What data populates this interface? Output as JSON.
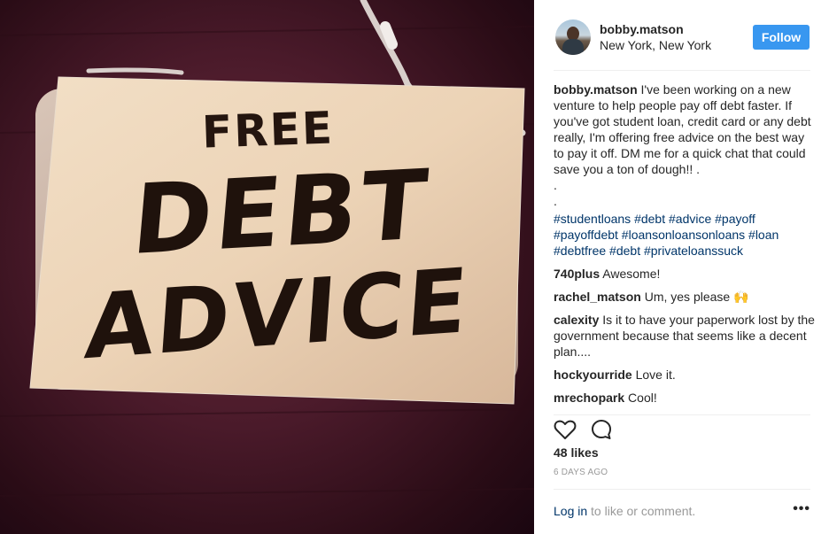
{
  "photo": {
    "sign_lines": [
      "FREE",
      "DEBT",
      "ADVICE"
    ]
  },
  "header": {
    "username": "bobby.matson",
    "location": "New York, New York",
    "follow_label": "Follow"
  },
  "caption": {
    "username": "bobby.matson",
    "text": "I've been working on a new venture to help people pay off debt faster. If you've got student loan, credit card or any debt really, I'm offering free advice on the best way to pay it off. DM me for a quick chat that could save you a ton of dough!! .\n.\n.",
    "hashtags": "#studentloans #debt #advice #payoff #payoffdebt #loansonloansonloans #loan #debtfree #debt #privateloanssuck"
  },
  "comments": [
    {
      "username": "740plus",
      "text": "Awesome!"
    },
    {
      "username": "rachel_matson",
      "text": "Um, yes please",
      "emoji": "🙌"
    },
    {
      "username": "calexity",
      "text": "Is it to have your paperwork lost by the government because that seems like a decent plan...."
    },
    {
      "username": "hockyourride",
      "text": "Love it."
    },
    {
      "username": "mrechopark",
      "text": "Cool!"
    }
  ],
  "likes": "48 likes",
  "timestamp": "6 DAYS AGO",
  "footer": {
    "login_link": "Log in",
    "login_rest": " to like or comment.",
    "more_label": "•••"
  },
  "icons": {
    "like": "heart-icon",
    "comment": "comment-bubble-icon",
    "more": "more-options-icon"
  },
  "colors": {
    "follow_button": "#3897f0",
    "hashtag": "#003569",
    "muted": "#999999"
  }
}
